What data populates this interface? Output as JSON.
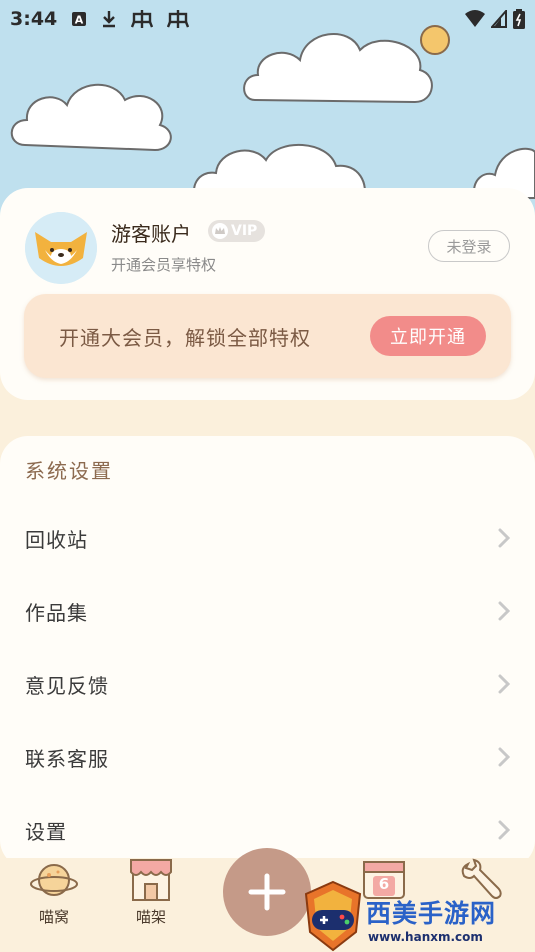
{
  "status_bar": {
    "time": "3:44",
    "icons": [
      "a-notification-icon",
      "download-icon",
      "bug-icon",
      "bug-icon",
      "wifi-icon",
      "signal-icon",
      "battery-icon"
    ]
  },
  "profile": {
    "account_name": "游客账户",
    "vip_badge": "VIP",
    "subtitle": "开通会员享特权",
    "login_button": "未登录",
    "avatar_icon": "fox-avatar-icon"
  },
  "vip_banner": {
    "text": "开通大会员，解锁全部特权",
    "button": "立即开通"
  },
  "settings": {
    "title": "系统设置",
    "items": [
      {
        "label": "回收站",
        "icon": "chevron-right-icon"
      },
      {
        "label": "作品集",
        "icon": "chevron-right-icon"
      },
      {
        "label": "意见反馈",
        "icon": "chevron-right-icon"
      },
      {
        "label": "联系客服",
        "icon": "chevron-right-icon"
      },
      {
        "label": "设置",
        "icon": "chevron-right-icon"
      }
    ]
  },
  "bottom_nav": {
    "items": [
      {
        "label": "喵窝",
        "icon": "planet-icon"
      },
      {
        "label": "喵架",
        "icon": "shop-icon"
      },
      {
        "label": "",
        "icon": "calendar-icon",
        "badge": "6"
      },
      {
        "label": "",
        "icon": "wrench-icon"
      }
    ],
    "fab_icon": "plus-icon"
  },
  "watermark": {
    "text": "西美手游网",
    "url": "www.hanxm.com"
  },
  "colors": {
    "sky": "#bfe0ee",
    "page_bg": "#fbf0dc",
    "card_bg": "#fffdf8",
    "banner_bg": "#fbe6d2",
    "accent_button": "#f28c8a",
    "fab": "#c59a88",
    "section_title": "#8c6a4f"
  }
}
